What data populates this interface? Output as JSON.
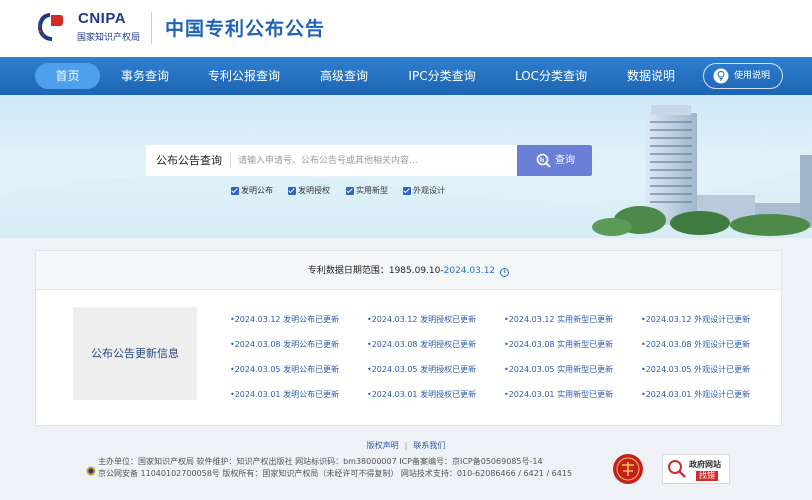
{
  "header": {
    "logo_text": "CNIPA",
    "logo_subtitle": "国家知识产权局",
    "site_title": "中国专利公布公告"
  },
  "nav": {
    "items": [
      {
        "label": "首页",
        "active": true
      },
      {
        "label": "事务查询"
      },
      {
        "label": "专利公报查询"
      },
      {
        "label": "高级查询"
      },
      {
        "label": "IPC分类查询"
      },
      {
        "label": "LOC分类查询"
      },
      {
        "label": "数据说明"
      }
    ],
    "help_label": "使用说明"
  },
  "search": {
    "label": "公布公告查询",
    "placeholder": "请输入申请号、公布公告号或其他相关内容...",
    "button_label": "查询",
    "checkboxes": [
      {
        "label": "发明公布",
        "checked": true
      },
      {
        "label": "发明授权",
        "checked": true
      },
      {
        "label": "实用新型",
        "checked": true
      },
      {
        "label": "外观设计",
        "checked": true
      }
    ]
  },
  "range": {
    "prefix": "专利数据日期范围：",
    "start": "1985.09.10-",
    "end": "2024.03.12"
  },
  "updates": {
    "label": "公布公告更新信息",
    "columns": [
      [
        "•2024.03.12 发明公布已更新",
        "•2024.03.08 发明公布已更新",
        "•2024.03.05 发明公布已更新",
        "•2024.03.01 发明公布已更新"
      ],
      [
        "•2024.03.12 发明授权已更新",
        "•2024.03.08 发明授权已更新",
        "•2024.03.05 发明授权已更新",
        "•2024.03.01 发明授权已更新"
      ],
      [
        "•2024.03.12 实用新型已更新",
        "•2024.03.08 实用新型已更新",
        "•2024.03.05 实用新型已更新",
        "•2024.03.01 实用新型已更新"
      ],
      [
        "•2024.03.12 外观设计已更新",
        "•2024.03.08 外观设计已更新",
        "•2024.03.05 外观设计已更新",
        "•2024.03.01 外观设计已更新"
      ]
    ]
  },
  "footer": {
    "link_copyright": "版权声明",
    "link_contact": "联系我们",
    "line1": "主办单位：国家知识产权局   软件维护：知识产权出版社   网站标识码：bm38000007   ICP备案编号：京ICP备05069085号-14",
    "line2": "京公网安备 11040102700058号  版权所有：国家知识产权局（未经许可不得复制）   网站技术支持：010-62086466 / 6421 / 6415",
    "gov_line1": "政府网站",
    "gov_line2": "找错"
  },
  "colors": {
    "nav_bg": "#1d65b3",
    "nav_active": "#4fa0ec",
    "search_button": "#6b7fd7",
    "link": "#2c5ca8",
    "title": "#1e63b8"
  }
}
